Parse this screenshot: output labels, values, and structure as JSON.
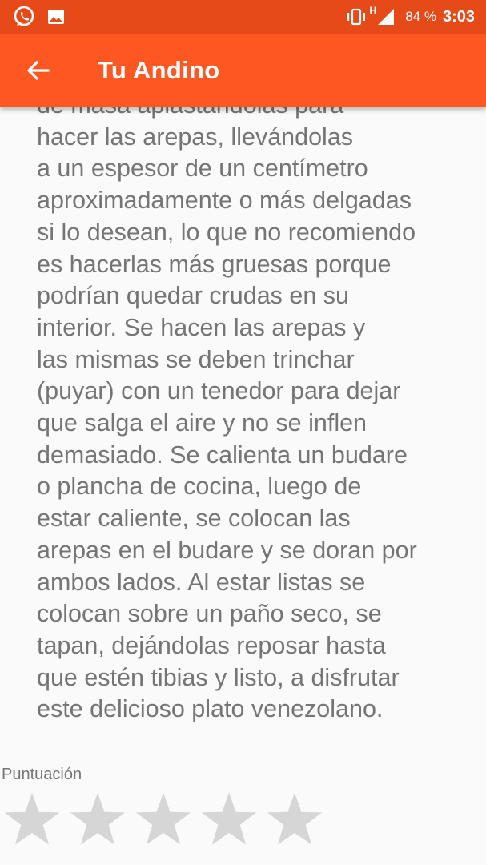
{
  "status_bar": {
    "icons_left": [
      "whatsapp-icon",
      "image-icon"
    ],
    "icons_right": [
      "vibrate-icon",
      "signal-icon"
    ],
    "network": "H",
    "battery": "84 %",
    "time": "3:03"
  },
  "app_bar": {
    "back_icon": "arrow-left-icon",
    "title": "Tu Andino",
    "color": "#ff5722",
    "status_color": "#e64a19"
  },
  "content": {
    "recipe_text": "de masa aplastándolas para\nhacer las arepas, llevándolas\na un espesor de un centímetro\naproximadamente o más delgadas\nsi lo desean, lo que no recomiendo\nes hacerlas más gruesas porque\npodrían quedar crudas en su\ninterior. Se hacen las arepas y\nlas mismas se deben trinchar\n(puyar) con un tenedor para dejar\nque salga el aire y no se inflen\ndemasiado. Se calienta un budare\no plancha de cocina, luego de\nestar caliente, se colocan las\narepas en el budare y se doran por\nambos lados. Al estar listas se\ncolocan sobre un paño seco, se\ntapan, dejándolas reposar hasta\nque estén tibias y listo, a disfrutar\neste delicioso plato venezolano.",
    "rating_label": "Puntuación",
    "rating": 0,
    "max_rating": 5,
    "star_color": "#d6d6d6"
  }
}
